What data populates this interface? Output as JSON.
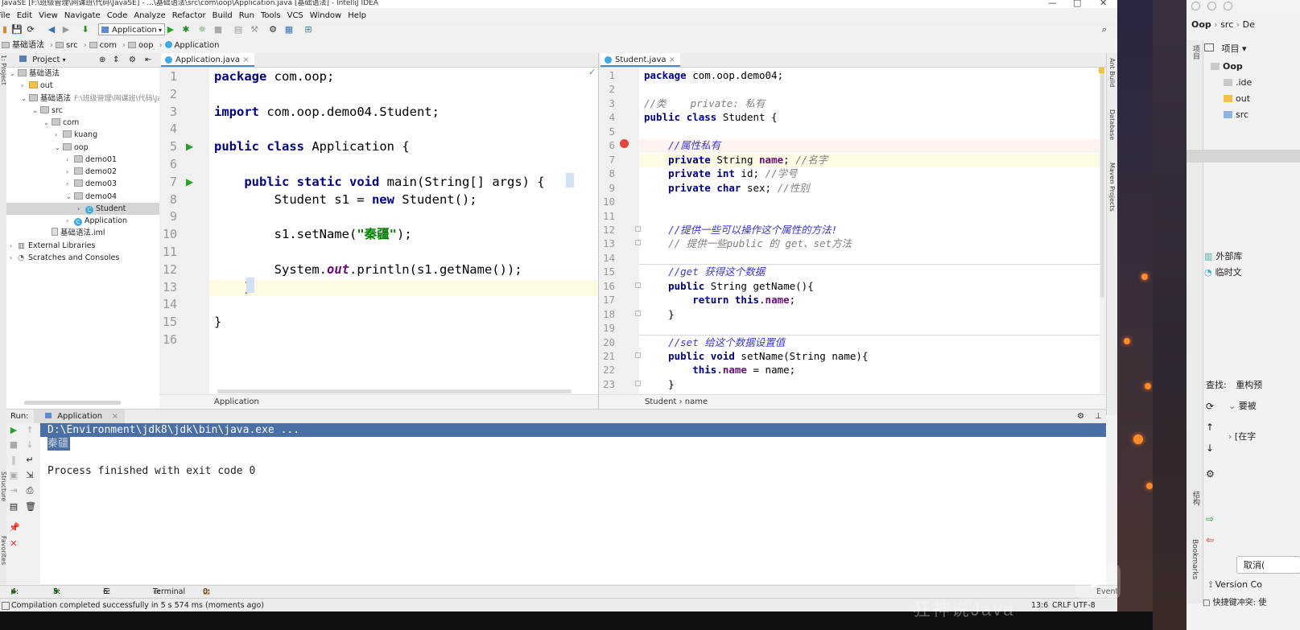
{
  "window": {
    "title": "JavaSE [F:\\班级管理\\网课班\\代码\\JavaSE] - ...\\基础语法\\src\\com\\oop\\Application.java [基础语法] - IntelliJ IDEA"
  },
  "menu": [
    "File",
    "Edit",
    "View",
    "Navigate",
    "Code",
    "Analyze",
    "Refactor",
    "Build",
    "Run",
    "Tools",
    "VCS",
    "Window",
    "Help"
  ],
  "toolbar": {
    "run_config": "Application"
  },
  "breadcrumb": [
    "基础语法",
    "src",
    "com",
    "oop",
    "Application"
  ],
  "project": {
    "header": "Project",
    "tree": [
      {
        "label": "基础语法",
        "type": "module",
        "depth": 0
      },
      {
        "label": "out",
        "type": "folder-orange",
        "depth": 1
      },
      {
        "label": "基础语法",
        "path": "F:\\班级管理\\网课班\\代码\\Ja",
        "type": "module",
        "depth": 1
      },
      {
        "label": "src",
        "type": "folder",
        "depth": 2
      },
      {
        "label": "com",
        "type": "folder",
        "depth": 3
      },
      {
        "label": "kuang",
        "type": "folder",
        "depth": 4
      },
      {
        "label": "oop",
        "type": "folder",
        "depth": 4
      },
      {
        "label": "demo01",
        "type": "folder",
        "depth": 5
      },
      {
        "label": "demo02",
        "type": "folder",
        "depth": 5
      },
      {
        "label": "demo03",
        "type": "folder",
        "depth": 5
      },
      {
        "label": "demo04",
        "type": "folder",
        "depth": 5
      },
      {
        "label": "Student",
        "type": "class",
        "depth": 6,
        "selected": true
      },
      {
        "label": "Application",
        "type": "class",
        "depth": 5
      },
      {
        "label": "基础语法.iml",
        "type": "file",
        "depth": 3
      },
      {
        "label": "External Libraries",
        "type": "lib",
        "depth": 0
      },
      {
        "label": "Scratches and Consoles",
        "type": "scratch",
        "depth": 0
      }
    ]
  },
  "editor_left": {
    "tab": "Application.java",
    "breadcrumb": "Application",
    "line_numbers": [
      "1",
      "2",
      "3",
      "4",
      "5",
      "6",
      "7",
      "8",
      "9",
      "10",
      "11",
      "12",
      "13",
      "14",
      "15",
      "16"
    ],
    "lines": [
      "package com.oop;",
      "",
      "import com.oop.demo04.Student;",
      "",
      "public class Application {",
      "",
      "    public static void main(String[] args) {",
      "        Student s1 = new Student();",
      "",
      "        s1.setName(\"秦疆\");",
      "",
      "        System.out.println(s1.getName());",
      "    }",
      "",
      "}",
      ""
    ]
  },
  "editor_right": {
    "tab": "Student.java",
    "breadcrumb": [
      "Student",
      "name"
    ],
    "line_numbers": [
      "1",
      "2",
      "3",
      "4",
      "5",
      "6",
      "7",
      "8",
      "9",
      "10",
      "11",
      "12",
      "13",
      "14",
      "15",
      "16",
      "17",
      "18",
      "19",
      "20",
      "21",
      "22",
      "23"
    ],
    "lines": [
      "package com.oop.demo04;",
      "",
      "//类    private: 私有",
      "public class Student {",
      "",
      "    //属性私有",
      "    private String name; //名字",
      "    private int id; //学号",
      "    private char sex; //性别",
      "",
      "",
      "    //提供一些可以操作这个属性的方法!",
      "    // 提供一些public 的 get、set方法",
      "",
      "    //get 获得这个数据",
      "    public String getName(){",
      "        return this.name;",
      "    }",
      "",
      "    //set 给这个数据设置值",
      "    public void setName(String name){",
      "        this.name = name;",
      "    }"
    ]
  },
  "run": {
    "label": "Run:",
    "tab": "Application",
    "console": [
      "D:\\Environment\\jdk8\\jdk\\bin\\java.exe ...",
      "秦疆",
      "",
      "Process finished with exit code 0"
    ]
  },
  "bottom_tabs": [
    "4: Run",
    "5: Debug",
    "6: TODO",
    "Terminal",
    "0: Messages"
  ],
  "event_log": "Event Log",
  "status": {
    "message": "Compilation completed successfully in 5 s 574 ms (moments ago)",
    "position": "13:6",
    "line_sep": "CRLF",
    "encoding": "UTF-8"
  },
  "side_tools": {
    "right": [
      "Ant Build",
      "Database",
      "Maven Projects"
    ],
    "left": [
      "Structure",
      "Favorites"
    ]
  },
  "second_ide": {
    "breadcrumb": [
      "Oop",
      "src",
      "De"
    ],
    "project_label": "项目",
    "tree": [
      "Oop",
      ".ide",
      "out",
      "src",
      "外部库",
      "临时文"
    ],
    "find_label": "查找:",
    "find_tab": "重构预",
    "find_items": [
      "要被",
      "[在字"
    ],
    "structure_tab": "结构",
    "bookmarks_tab": "Bookmarks",
    "cancel_button": "取消(",
    "version_control": "Version Co",
    "status": "快捷键冲突: 使"
  },
  "watermark": "狂神说Java"
}
